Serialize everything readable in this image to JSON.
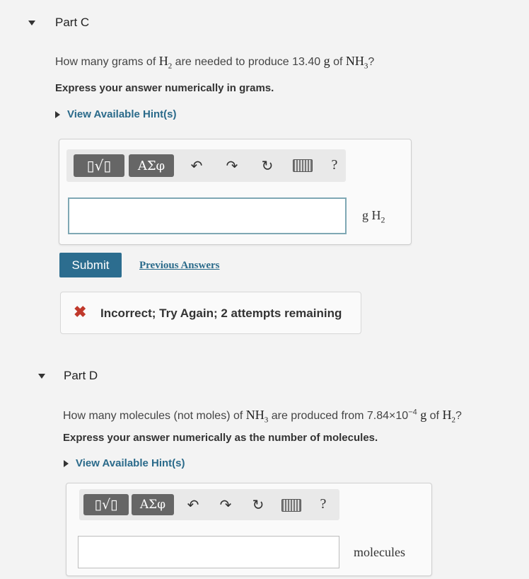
{
  "partC": {
    "title": "Part C",
    "question": {
      "pre": "How many grams of",
      "h": "H",
      "h_sub": "2",
      "mid": "are needed to produce 13.40",
      "g": "g",
      "of": "of",
      "nh": "NH",
      "nh_sub": "3",
      "end": "?"
    },
    "instruction": "Express your answer numerically in grams.",
    "hint_label": "View Available Hint(s)",
    "toolbar": {
      "templates_label": "▯√▯",
      "greek_label": "ΑΣφ",
      "help_label": "?"
    },
    "answer_value": "",
    "unit": {
      "text": "g H",
      "sub": "2"
    },
    "submit_label": "Submit",
    "previous_answers_label": "Previous Answers",
    "feedback": {
      "icon": "x-icon",
      "text": "Incorrect; Try Again; 2 attempts remaining",
      "color": "#c0392b"
    }
  },
  "partD": {
    "title": "Part D",
    "question": {
      "pre": "How many molecules (not moles) of",
      "nh": "NH",
      "nh_sub": "3",
      "mid": "are produced from 7.84×10",
      "exp": "−4",
      "g": "g",
      "of": "of",
      "h": "H",
      "h_sub": "2",
      "end": "?"
    },
    "instruction": "Express your answer numerically as the number of molecules.",
    "hint_label": "View Available Hint(s)",
    "toolbar": {
      "templates_label": "▯√▯",
      "greek_label": "ΑΣφ",
      "help_label": "?"
    },
    "answer_value": "",
    "unit": {
      "text": "molecules"
    }
  },
  "colors": {
    "accent": "#2c6d8f",
    "error": "#c0392b"
  }
}
